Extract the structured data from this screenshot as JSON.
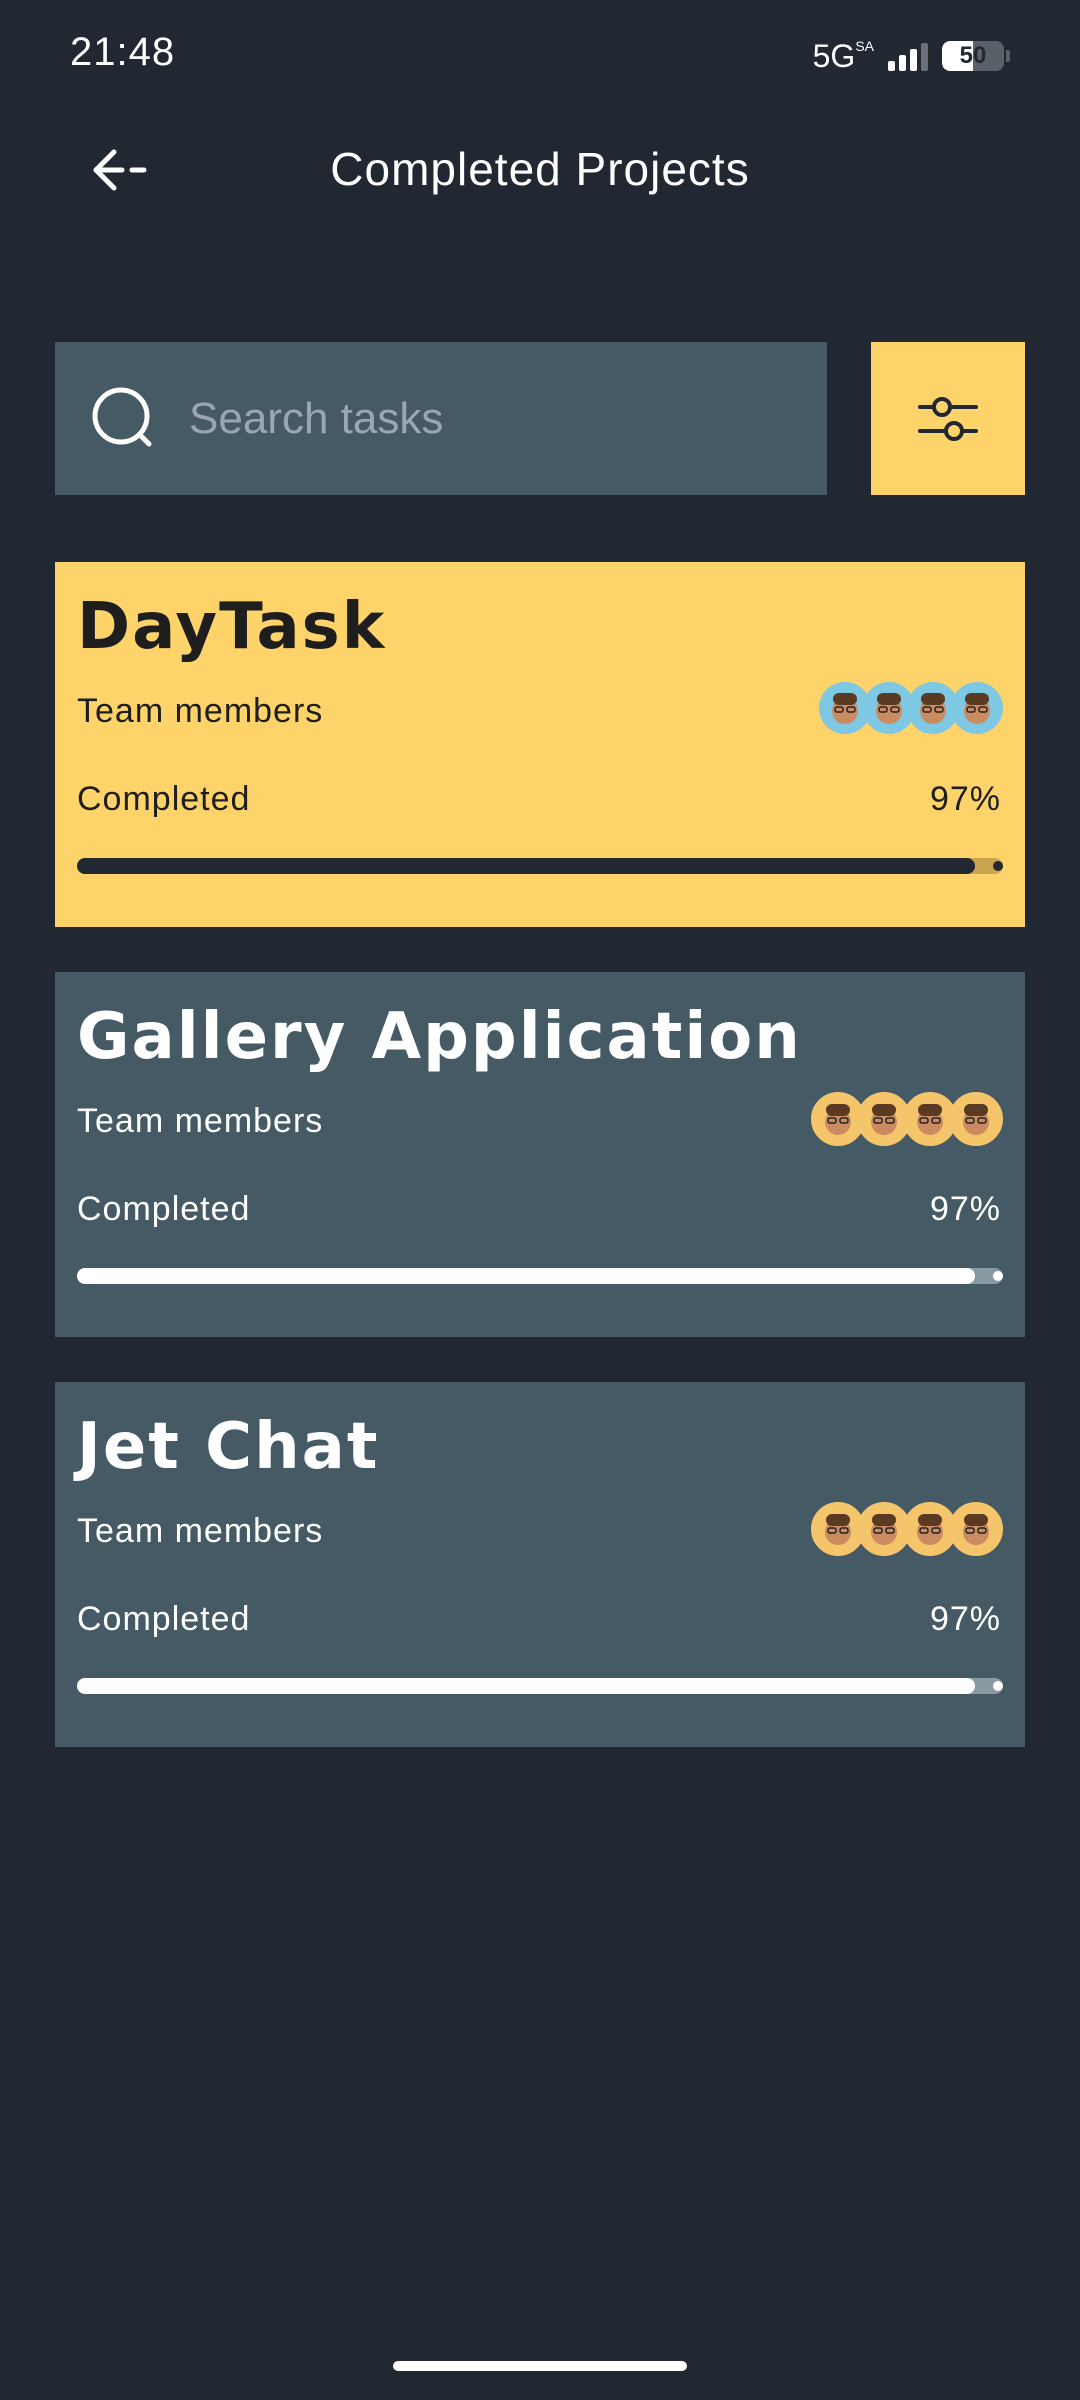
{
  "status_bar": {
    "time": "21:48",
    "network": "5G",
    "network_sup": "SA",
    "battery_percent": "50"
  },
  "header": {
    "title": "Completed Projects",
    "back_icon": "arrow-left-icon"
  },
  "search": {
    "placeholder": "Search tasks",
    "value": "",
    "icon": "search-icon"
  },
  "filter": {
    "icon": "sliders-icon"
  },
  "projects": [
    {
      "title": "DayTask",
      "members_label": "Team members",
      "completed_label": "Completed",
      "percent_text": "97%",
      "progress": 0.97,
      "theme": "yellow"
    },
    {
      "title": "Gallery Application",
      "members_label": "Team members",
      "completed_label": "Completed",
      "percent_text": "97%",
      "progress": 0.97,
      "theme": "slate"
    },
    {
      "title": "Jet Chat",
      "members_label": "Team members",
      "completed_label": "Completed",
      "percent_text": "97%",
      "progress": 0.97,
      "theme": "slate"
    }
  ],
  "colors": {
    "background": "#212832",
    "accent": "#FED36A",
    "card": "#455A64"
  }
}
